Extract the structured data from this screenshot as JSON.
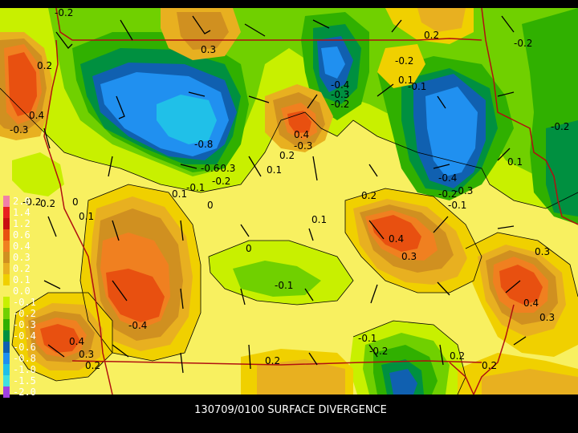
{
  "title": "130709/0100 SURFACE DIVERGENCE",
  "colors": {
    "bg": "#000000",
    "border": "#b01010",
    "contour": "#000000",
    "barb": "#000000"
  },
  "legend": {
    "entries": [
      {
        "label": "2.0",
        "color": "#f080a8"
      },
      {
        "label": "1.4",
        "color": "#e82020"
      },
      {
        "label": "1.2",
        "color": "#c81010"
      },
      {
        "label": "0.6",
        "color": "#e85010"
      },
      {
        "label": "0.4",
        "color": "#f08020"
      },
      {
        "label": "0.3",
        "color": "#d09020"
      },
      {
        "label": "0.2",
        "color": "#e8b020"
      },
      {
        "label": "0.1",
        "color": "#f0d000"
      },
      {
        "label": "0.0",
        "color": "#f8f060"
      },
      {
        "label": "-0.1",
        "color": "#c8f000"
      },
      {
        "label": "-0.2",
        "color": "#70d000"
      },
      {
        "label": "-0.3",
        "color": "#30b000"
      },
      {
        "label": "-0.4",
        "color": "#009040"
      },
      {
        "label": "-0.6",
        "color": "#1060b0"
      },
      {
        "label": "-0.8",
        "color": "#2090f0"
      },
      {
        "label": "-1.0",
        "color": "#20c0e8"
      },
      {
        "label": "-1.5",
        "color": "#40e0e0"
      },
      {
        "label": "-2.0",
        "color": "#a040e0"
      }
    ]
  },
  "contour_labels": [
    {
      "text": "-0.2"
    },
    {
      "text": "0.3"
    },
    {
      "text": "0.2"
    },
    {
      "text": "-0.2"
    },
    {
      "text": "0.2"
    },
    {
      "text": "0.4"
    },
    {
      "text": "-0.3"
    },
    {
      "text": "-0.2"
    },
    {
      "text": "-0.4"
    },
    {
      "text": "-0.3"
    },
    {
      "text": "-0.2"
    },
    {
      "text": "0.1"
    },
    {
      "text": "-0.1"
    },
    {
      "text": "-0.8"
    },
    {
      "text": "0.4"
    },
    {
      "text": "-0.3"
    },
    {
      "text": "0.2"
    },
    {
      "text": "0.1"
    },
    {
      "text": "-0.6"
    },
    {
      "text": "-0.3"
    },
    {
      "text": "-0.2"
    },
    {
      "text": "-0.1"
    },
    {
      "text": "0.1"
    },
    {
      "text": "0"
    },
    {
      "text": "-0.4"
    },
    {
      "text": "-0.3"
    },
    {
      "text": "-0.2"
    },
    {
      "text": "-0.1"
    },
    {
      "text": "0.1"
    },
    {
      "text": "-0.2"
    },
    {
      "text": "-0.2"
    },
    {
      "text": "0"
    },
    {
      "text": "0.2"
    },
    {
      "text": "0.1"
    },
    {
      "text": "0.4"
    },
    {
      "text": "0.3"
    },
    {
      "text": "0.2"
    },
    {
      "text": "0.1"
    },
    {
      "text": "0"
    },
    {
      "text": "-0.1"
    },
    {
      "text": "-0.4"
    },
    {
      "text": "0.4"
    },
    {
      "text": "0.3"
    },
    {
      "text": "0.2"
    },
    {
      "text": "0.4"
    },
    {
      "text": "0.3"
    },
    {
      "text": "-0.1"
    },
    {
      "text": "-0.2"
    },
    {
      "text": "0.2"
    },
    {
      "text": "0.2"
    },
    {
      "text": "0.3"
    },
    {
      "text": "0.2"
    }
  ]
}
